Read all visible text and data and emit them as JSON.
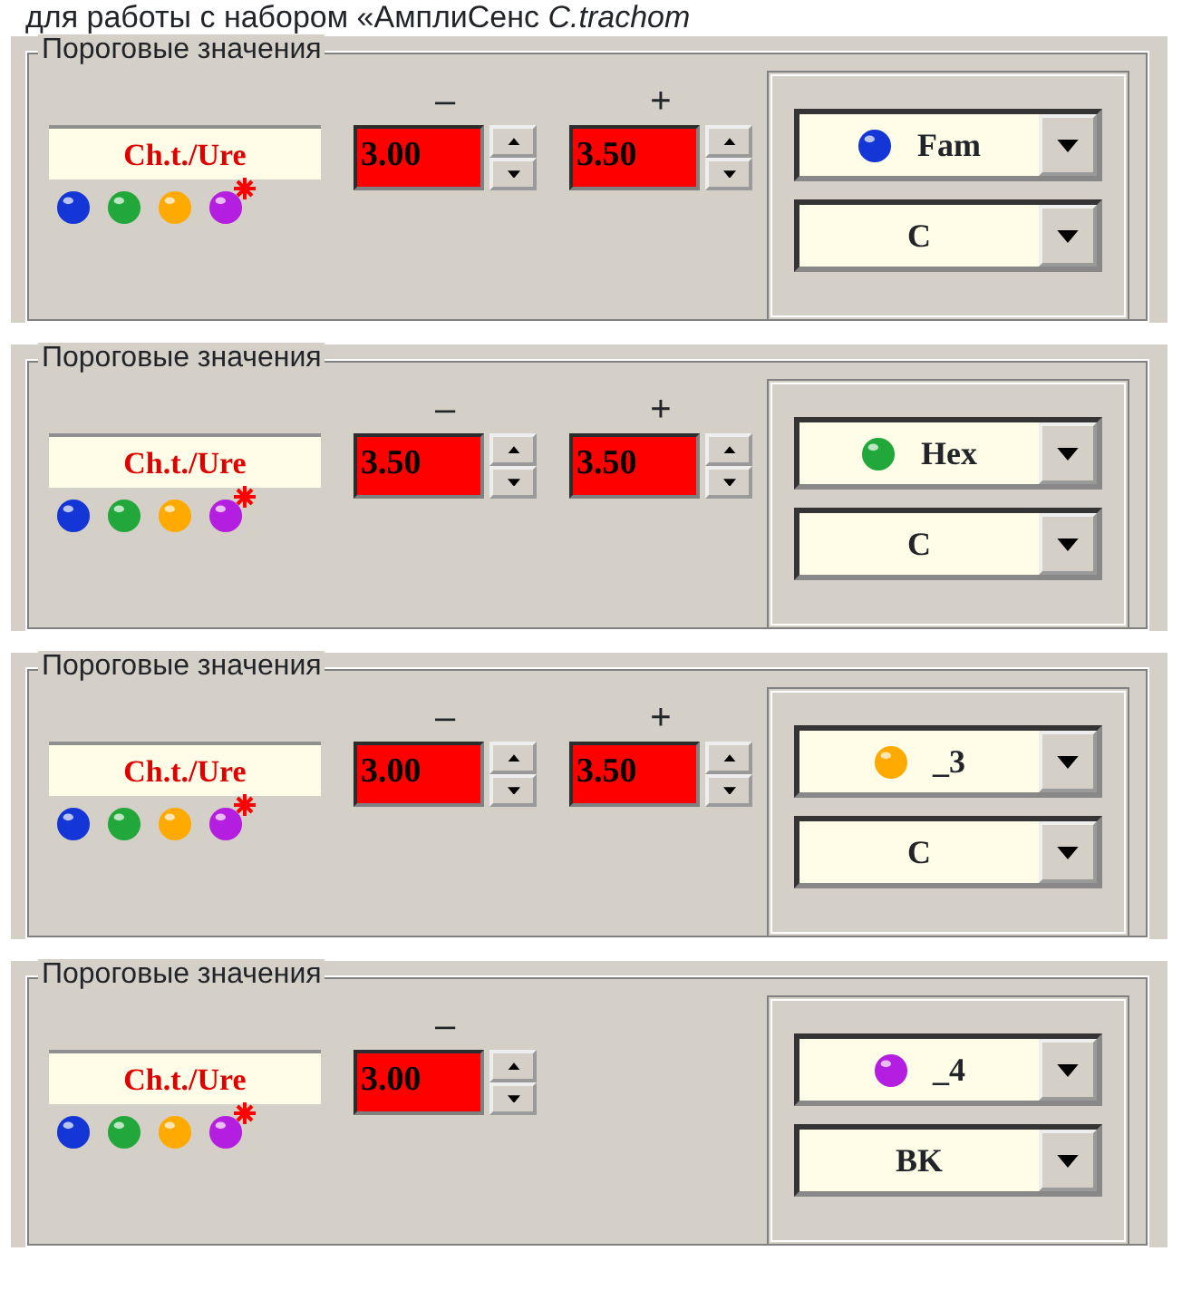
{
  "caption": {
    "text": "для работы с набором «АмплиСенс",
    "italic_text": "C.trachom"
  },
  "panels": [
    {
      "title": "Пороговые значения",
      "label": "Ch.t./Ure",
      "dots": [
        {
          "color": "#1436d6",
          "starred": false
        },
        {
          "color": "#22a83a",
          "starred": false
        },
        {
          "color": "#ffaa00",
          "starred": false
        },
        {
          "color": "#b41ee0",
          "starred": true
        }
      ],
      "spinners": [
        {
          "sign": "–",
          "value": "3.00"
        },
        {
          "sign": "+",
          "value": "3.50"
        }
      ],
      "channel": {
        "color": "#1436d6",
        "value": "Fam"
      },
      "type": {
        "value": "C"
      }
    },
    {
      "title": "Пороговые значения",
      "label": "Ch.t./Ure",
      "dots": [
        {
          "color": "#1436d6",
          "starred": false
        },
        {
          "color": "#22a83a",
          "starred": false
        },
        {
          "color": "#ffaa00",
          "starred": false
        },
        {
          "color": "#b41ee0",
          "starred": true
        }
      ],
      "spinners": [
        {
          "sign": "–",
          "value": "3.50"
        },
        {
          "sign": "+",
          "value": "3.50"
        }
      ],
      "channel": {
        "color": "#22a83a",
        "value": "Hex"
      },
      "type": {
        "value": "C"
      }
    },
    {
      "title": "Пороговые значения",
      "label": "Ch.t./Ure",
      "dots": [
        {
          "color": "#1436d6",
          "starred": false
        },
        {
          "color": "#22a83a",
          "starred": false
        },
        {
          "color": "#ffaa00",
          "starred": false
        },
        {
          "color": "#b41ee0",
          "starred": true
        }
      ],
      "spinners": [
        {
          "sign": "–",
          "value": "3.00"
        },
        {
          "sign": "+",
          "value": "3.50"
        }
      ],
      "channel": {
        "color": "#ffaa00",
        "value": "_3"
      },
      "type": {
        "value": "C"
      }
    },
    {
      "title": "Пороговые значения",
      "label": "Ch.t./Ure",
      "dots": [
        {
          "color": "#1436d6",
          "starred": false
        },
        {
          "color": "#22a83a",
          "starred": false
        },
        {
          "color": "#ffaa00",
          "starred": false
        },
        {
          "color": "#b41ee0",
          "starred": true
        }
      ],
      "spinners": [
        {
          "sign": "–",
          "value": "3.00"
        }
      ],
      "channel": {
        "color": "#b41ee0",
        "value": "_4"
      },
      "type": {
        "value": "BK"
      }
    }
  ]
}
